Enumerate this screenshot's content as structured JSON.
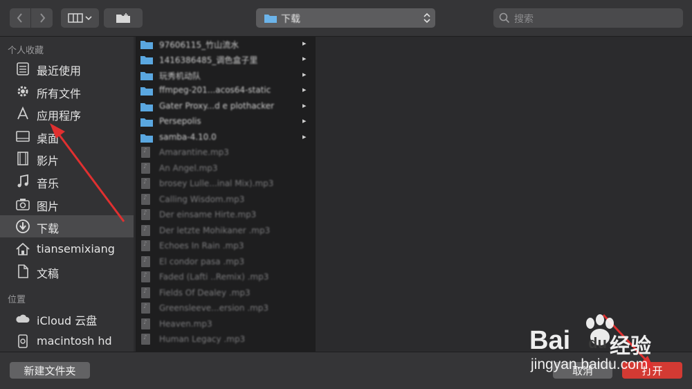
{
  "toolbar": {
    "back_icon": "chevron-left-icon",
    "forward_icon": "chevron-right-icon",
    "view_icon": "column-view-icon",
    "new_folder_icon": "folder-add-icon",
    "location": "下载",
    "search_placeholder": "搜索"
  },
  "sidebar": {
    "favorites_title": "个人收藏",
    "favorites": [
      {
        "label": "最近使用",
        "icon": "recents-icon"
      },
      {
        "label": "所有文件",
        "icon": "gear-icon"
      },
      {
        "label": "应用程序",
        "icon": "applications-icon"
      },
      {
        "label": "桌面",
        "icon": "desktop-icon"
      },
      {
        "label": "影片",
        "icon": "film-icon"
      },
      {
        "label": "音乐",
        "icon": "music-icon"
      },
      {
        "label": "图片",
        "icon": "camera-icon"
      },
      {
        "label": "下载",
        "icon": "download-icon"
      },
      {
        "label": "tiansemixiang",
        "icon": "home-icon"
      },
      {
        "label": "文稿",
        "icon": "document-icon"
      }
    ],
    "locations_title": "位置",
    "locations": [
      {
        "label": "iCloud 云盘",
        "icon": "cloud-icon"
      },
      {
        "label": "macintosh hd",
        "icon": "disk-icon"
      }
    ]
  },
  "files": {
    "folders": [
      "97606115_竹山流水",
      "1416386485_调色盒子里",
      "玩秀机动队",
      "ffmpeg-201...acos64-static",
      "Gater Proxy...d e plothacker",
      "Persepolis",
      "samba-4.10.0"
    ],
    "items": [
      "Amarantine.mp3",
      "An Angel.mp3",
      "brosey Lulle...inal Mix).mp3",
      "Calling Wisdom.mp3",
      "Der einsame Hirte.mp3",
      "Der letzte Mohikaner .mp3",
      "Echoes In Rain .mp3",
      "El condor pasa .mp3",
      "Faded (Lafti ..Remix) .mp3",
      "Fields Of Dealey .mp3",
      "Greensleeve...ersion .mp3",
      "Heaven.mp3",
      "Human Legacy .mp3"
    ]
  },
  "bottom": {
    "new_folder": "新建文件夹",
    "cancel": "取消",
    "open": "打开"
  },
  "watermark": {
    "brand": "Bai",
    "brand2": "du",
    "suffix": "经验",
    "url": "jingyan.baidu.com"
  },
  "colors": {
    "accent_open": "#d33a33",
    "folder_blue": "#5aa7e0",
    "arrow_red": "#e03030"
  }
}
